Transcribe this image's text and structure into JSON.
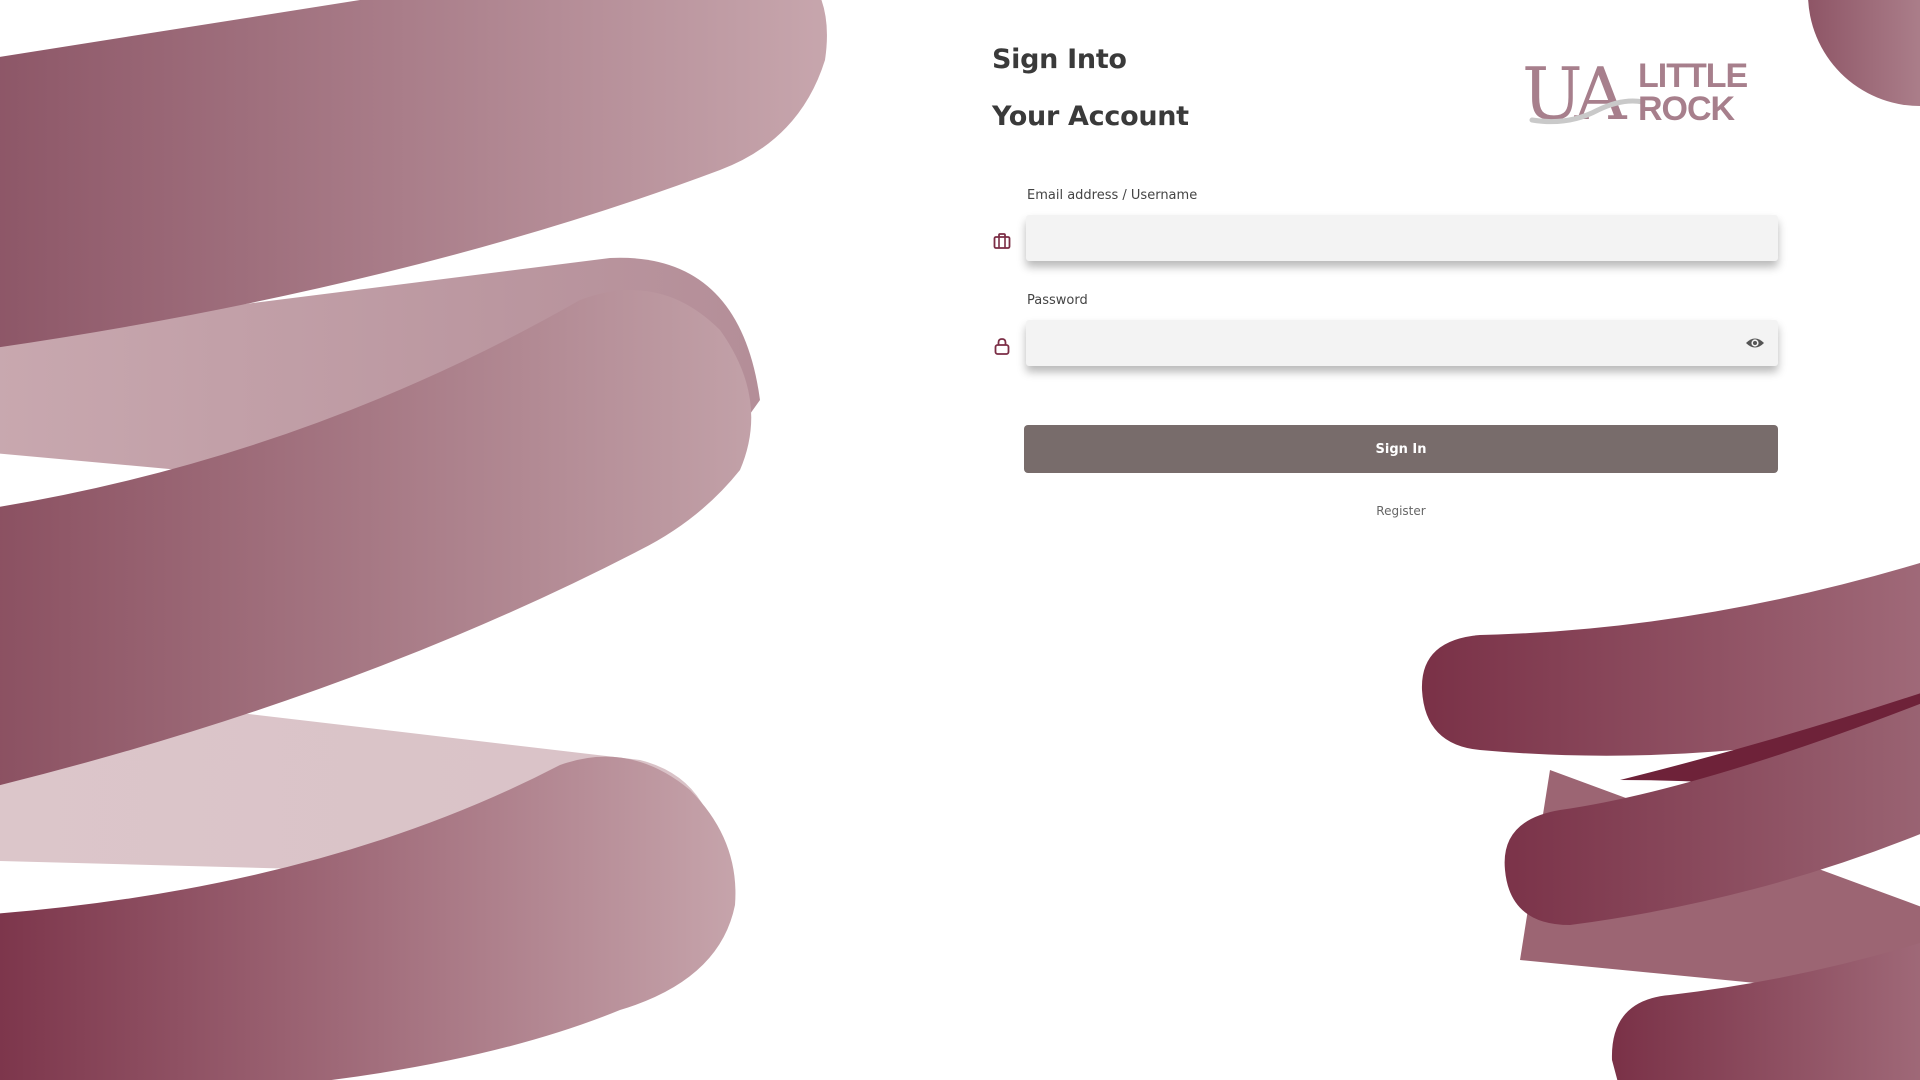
{
  "page": {
    "heading_line1": "Sign Into",
    "heading_line2": "Your Account"
  },
  "logo": {
    "initials": "UA",
    "line1": "LITTLE",
    "line2": "ROCK"
  },
  "form": {
    "email_label": "Email address / Username",
    "email_value": "",
    "password_label": "Password",
    "password_value": "",
    "signin_label": "Sign In",
    "register_label": "Register"
  },
  "icons": {
    "email": "briefcase-icon",
    "password": "lock-icon",
    "toggle_visibility": "eye-icon"
  },
  "colors": {
    "brand_maroon": "#7b2d45",
    "brand_light": "#a77f8c",
    "button": "#786c6b",
    "input_bg": "#f3f3f3",
    "heading": "#3a3a3a"
  }
}
